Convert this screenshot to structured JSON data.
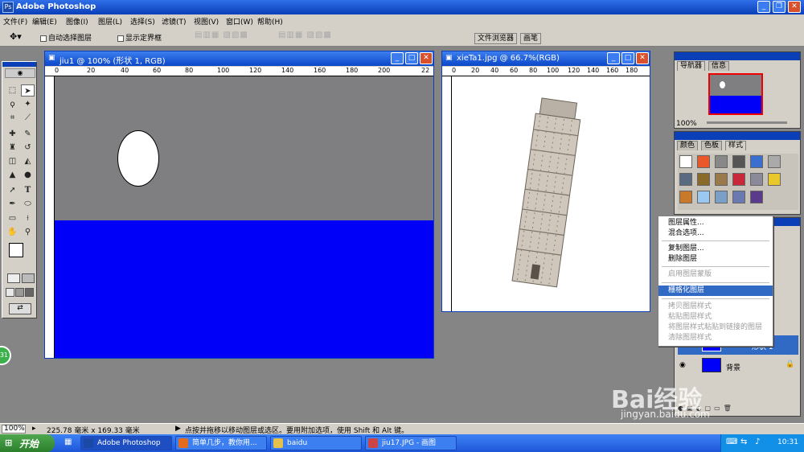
{
  "app": {
    "title": "Adobe Photoshop"
  },
  "menu": [
    "文件(F)",
    "编辑(E)",
    "图像(I)",
    "图层(L)",
    "选择(S)",
    "滤镜(T)",
    "视图(V)",
    "窗口(W)",
    "帮助(H)"
  ],
  "options": {
    "auto_select_layer": "自动选择图层",
    "show_bounding_box": "显示定界框",
    "file_browser_tab": "文件浏览器",
    "brushes_tab": "画笔"
  },
  "doc1": {
    "title": "jiu1 @ 100% (形状 1, RGB)",
    "ruler_marks": [
      "0",
      "20",
      "40",
      "60",
      "80",
      "100",
      "120",
      "140",
      "160",
      "180",
      "200",
      "22"
    ],
    "colors": {
      "top": "#7f7e80",
      "bottom": "#0000f8",
      "ellipse": "#ffffff"
    }
  },
  "doc2": {
    "title": "xieTa1.jpg @ 66.7%(RGB)",
    "ruler_marks": [
      "0",
      "20",
      "40",
      "60",
      "80",
      "100",
      "120",
      "140",
      "160",
      "180"
    ]
  },
  "navigator": {
    "tabs": [
      "导航器",
      "信息"
    ],
    "zoom": "100%"
  },
  "styles_panel": {
    "tabs": [
      "颜色",
      "色板",
      "样式"
    ]
  },
  "context_menu": {
    "items": [
      {
        "label": "图层属性...",
        "state": "normal"
      },
      {
        "label": "混合选项...",
        "state": "normal"
      },
      {
        "label": "复制图层...",
        "state": "normal"
      },
      {
        "label": "删除图层",
        "state": "normal"
      },
      {
        "label": "启用图层蒙版",
        "state": "disabled"
      },
      {
        "label": "栅格化图层",
        "state": "selected"
      },
      {
        "label": "拷贝图层样式",
        "state": "disabled"
      },
      {
        "label": "粘贴图层样式",
        "state": "disabled"
      },
      {
        "label": "将图层样式粘贴到链接的图层",
        "state": "disabled"
      },
      {
        "label": "清除图层样式",
        "state": "disabled"
      }
    ]
  },
  "layers": {
    "rows": [
      {
        "name": "形状 1"
      },
      {
        "name": "背景"
      }
    ]
  },
  "status": {
    "zoom": "100%",
    "doc_size": "225.78 毫米 x 169.33 毫米",
    "hint": "点按并拖移以移动图层或选区。要用附加选项，使用 Shift 和 Alt 键。"
  },
  "watermark": {
    "brand": "Bai经验",
    "url": "jingyan.baidu.com"
  },
  "taskbar": {
    "start": "开始",
    "tasks": [
      {
        "label": "Adobe Photoshop",
        "color": "#1b4aa6"
      },
      {
        "label": "简单几步，教你用...",
        "color": "#e36b1d"
      },
      {
        "label": "baidu",
        "color": "#e5c04a"
      },
      {
        "label": "jiu17.JPG - 画图",
        "color": "#c44"
      }
    ],
    "clock": "10:31"
  }
}
